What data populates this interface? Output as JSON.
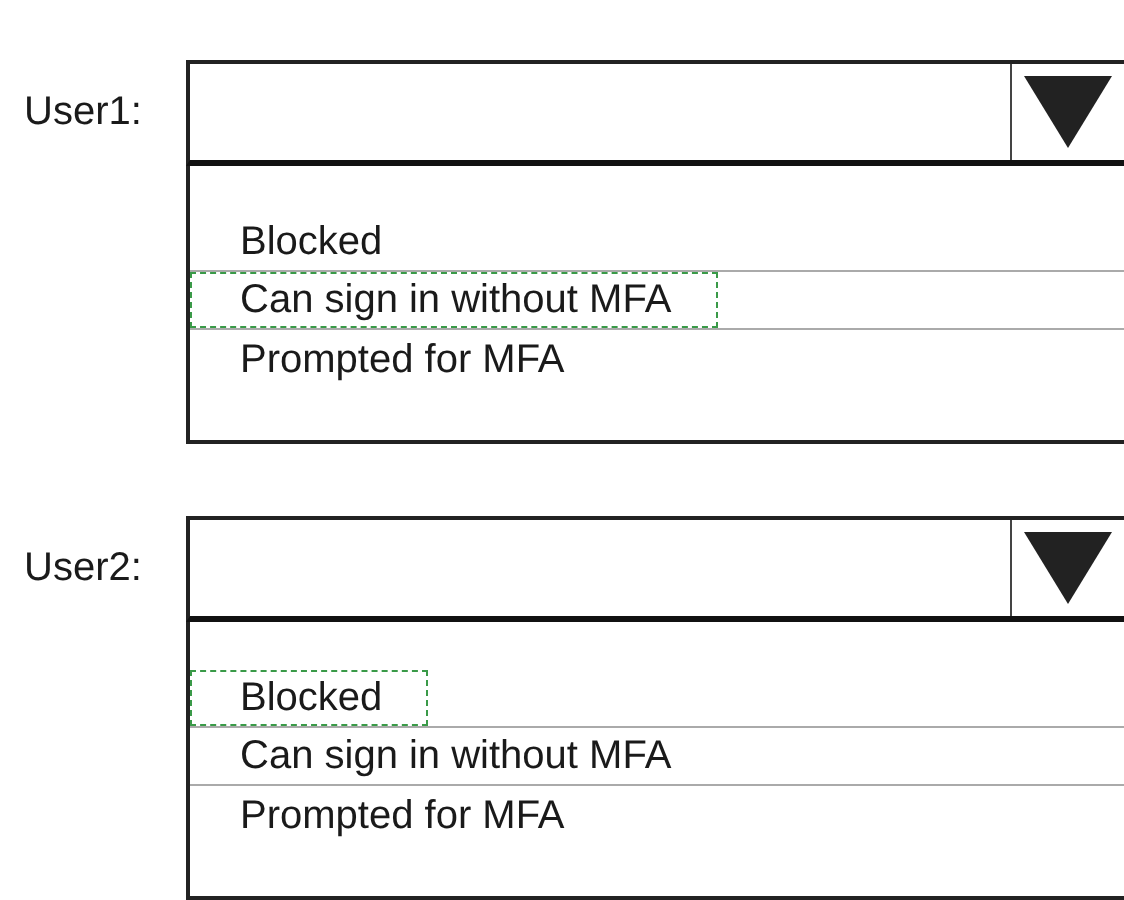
{
  "dropdowns": [
    {
      "label": "User1:",
      "options": [
        {
          "text": "Blocked",
          "selected": false
        },
        {
          "text": "Can sign in without MFA",
          "selected": true
        },
        {
          "text": "Prompted for MFA",
          "selected": false
        }
      ]
    },
    {
      "label": "User2:",
      "options": [
        {
          "text": "Blocked",
          "selected": true
        },
        {
          "text": "Can sign in without MFA",
          "selected": false
        },
        {
          "text": "Prompted for MFA",
          "selected": false
        }
      ]
    }
  ]
}
